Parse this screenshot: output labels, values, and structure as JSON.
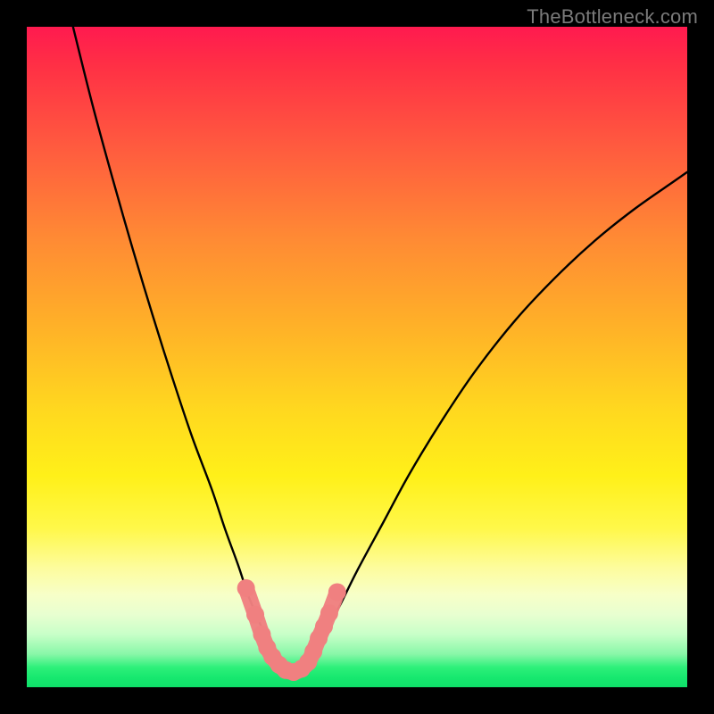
{
  "watermark": "TheBottleneck.com",
  "colors": {
    "frame": "#000000",
    "curve": "#000000",
    "marker_fill": "#f08080",
    "marker_stroke": "#e06a6a"
  },
  "chart_data": {
    "type": "line",
    "title": "",
    "xlabel": "",
    "ylabel": "",
    "xlim": [
      0,
      100
    ],
    "ylim": [
      0,
      100
    ],
    "grid": false,
    "legend": false,
    "series": [
      {
        "name": "left-branch",
        "x": [
          7,
          10,
          13,
          16,
          19,
          22,
          25,
          28,
          30,
          32,
          33.5,
          35,
          36,
          37,
          38,
          39,
          40
        ],
        "values": [
          100,
          88,
          77,
          66.5,
          56.5,
          47,
          38,
          30,
          24,
          18.5,
          14,
          10.4,
          8,
          6,
          4.4,
          3.2,
          2.2
        ]
      },
      {
        "name": "right-branch",
        "x": [
          40,
          42,
          44,
          47,
          50,
          54,
          58,
          63,
          68,
          74,
          80,
          86,
          92,
          98,
          100
        ],
        "values": [
          2.2,
          3.6,
          6.4,
          11.6,
          17.6,
          25,
          32.4,
          40.6,
          48,
          55.6,
          62,
          67.6,
          72.4,
          76.6,
          78
        ]
      }
    ],
    "markers": {
      "name": "highlighted-points",
      "points": [
        {
          "x": 33.2,
          "y": 15.0
        },
        {
          "x": 34.6,
          "y": 11.0
        },
        {
          "x": 35.6,
          "y": 8.0
        },
        {
          "x": 36.4,
          "y": 6.0
        },
        {
          "x": 37.2,
          "y": 4.6
        },
        {
          "x": 38.2,
          "y": 3.4
        },
        {
          "x": 39.2,
          "y": 2.6
        },
        {
          "x": 40.4,
          "y": 2.3
        },
        {
          "x": 41.6,
          "y": 2.8
        },
        {
          "x": 42.6,
          "y": 3.8
        },
        {
          "x": 43.4,
          "y": 5.4
        },
        {
          "x": 44.2,
          "y": 7.4
        },
        {
          "x": 45.0,
          "y": 9.2
        },
        {
          "x": 45.8,
          "y": 11.2
        },
        {
          "x": 47.0,
          "y": 14.4
        }
      ]
    }
  }
}
